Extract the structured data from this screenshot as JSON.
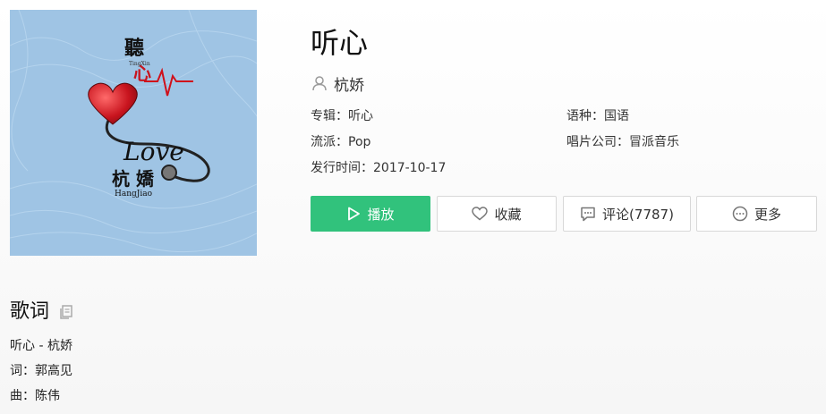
{
  "song": {
    "title": "听心",
    "singer": "杭娇",
    "album_label": "专辑：",
    "album": "听心",
    "language_label": "语种：",
    "language": "国语",
    "genre_label": "流派：",
    "genre": "Pop",
    "company_label": "唱片公司：",
    "company": "冒派音乐",
    "release_label": "发行时间：",
    "release": "2017-10-17"
  },
  "cover": {
    "top_char": "聽",
    "heart_char": "心",
    "pinyin_top": "TingXin",
    "love": "Love",
    "artist_cn": "杭 嬌",
    "artist_en": "HangJiao"
  },
  "actions": {
    "play": "播放",
    "favorite": "收藏",
    "comment": "评论(7787)",
    "more": "更多"
  },
  "lyrics": {
    "heading": "歌词",
    "lines": [
      "听心 - 杭娇",
      "词：郭高见",
      "曲：陈伟"
    ]
  },
  "colors": {
    "play_green": "#31c27c",
    "cover_blue": "#9fc4e4",
    "heart_red": "#c8141e"
  },
  "icons": {
    "singer": "user-icon",
    "play": "play-icon",
    "favorite": "heart-icon",
    "comment": "comment-icon",
    "more": "more-dots-icon",
    "copy": "copy-icon"
  }
}
